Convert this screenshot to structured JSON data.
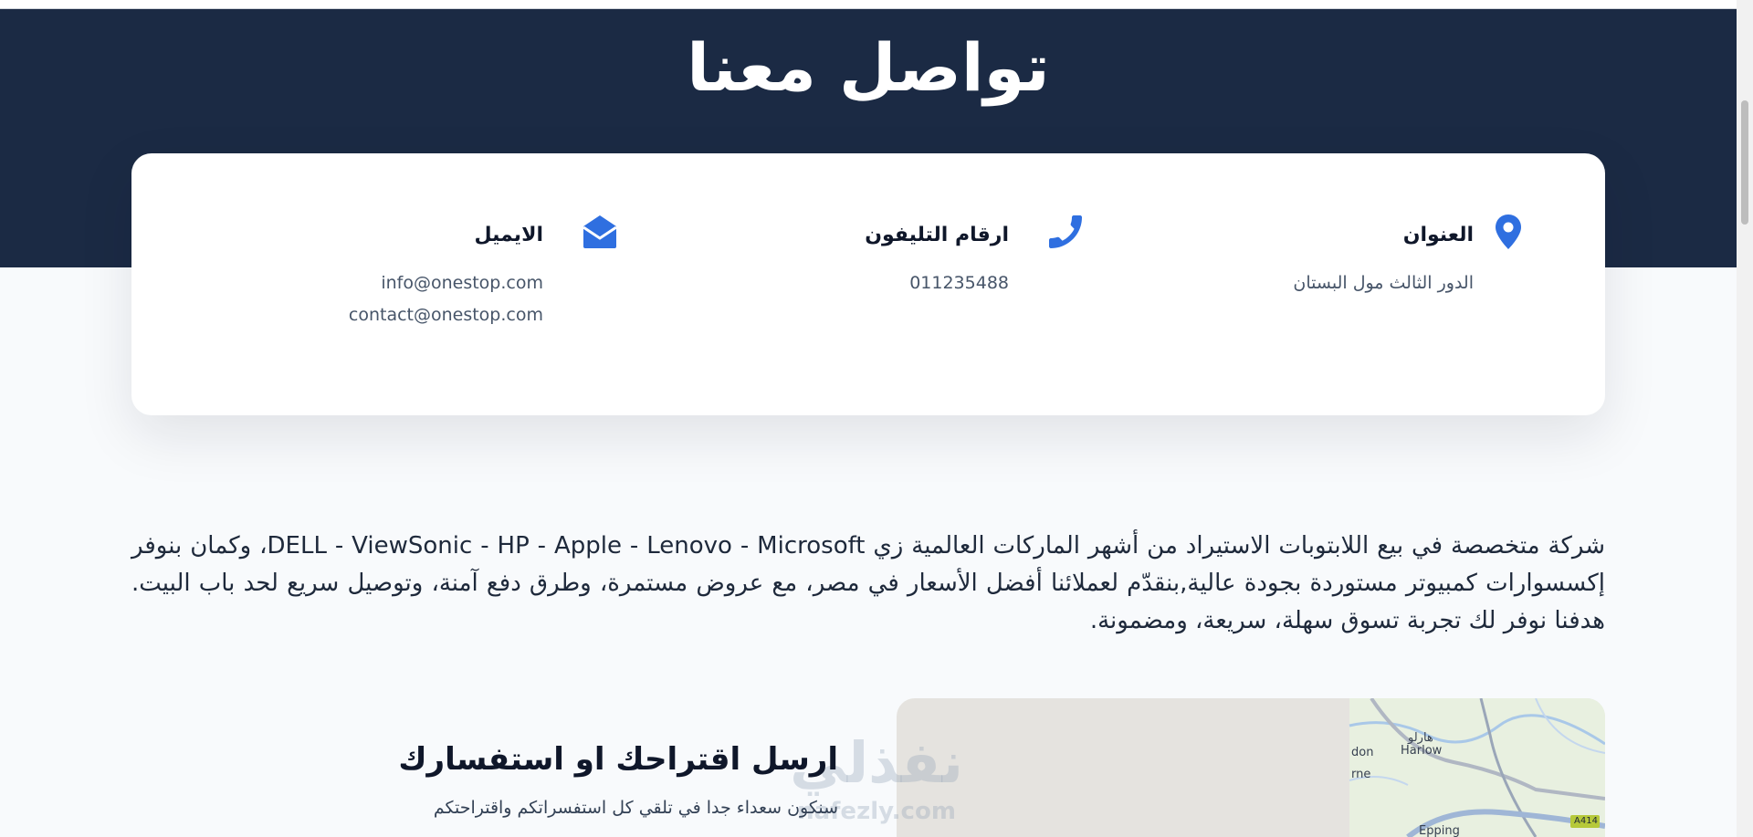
{
  "hero": {
    "title": "تواصل معنا"
  },
  "contact_cards": {
    "address": {
      "title": "العنوان",
      "lines": [
        "الدور الثالث مول البستان"
      ],
      "icon": "map-pin-icon"
    },
    "phone": {
      "title": "ارقام التليفون",
      "lines": [
        "011235488"
      ],
      "icon": "phone-icon"
    },
    "email": {
      "title": "الايميل",
      "lines": [
        "info@onestop.com",
        "contact@onestop.com"
      ],
      "icon": "envelope-open-icon"
    }
  },
  "about": {
    "text": "شركة متخصصة في بيع اللابتوبات الاستيراد من أشهر الماركات العالمية زي DELL - ViewSonic - HP - Apple - Lenovo - Microsoft، وكمان بنوفر إكسسوارات كمبيوتر مستوردة بجودة عالية,بنقدّم لعملائنا أفضل الأسعار في مصر، مع عروض مستمرة، وطرق دفع آمنة، وتوصيل سريع لحد باب البيت. هدفنا نوفر لك تجربة تسوق سهلة، سريعة، ومضمونة."
  },
  "form": {
    "title": "ارسل اقتراحك او استفسارك",
    "subtitle": "سنكون سعداء جدا في تلقي كل استفسراتكم واقتراحتكم"
  },
  "map": {
    "labels": {
      "harlow_ar": "هارلو",
      "harlow_en": "Harlow",
      "don": "don",
      "rne": "rne",
      "road": "A414",
      "epping": "Epping"
    }
  },
  "watermark": {
    "arabic": "نفذلي",
    "latin": "nafezly.com"
  },
  "colors": {
    "accent": "#2f6fe0",
    "hero_bg": "#1b2a44",
    "page_bg": "#f8fafc"
  }
}
